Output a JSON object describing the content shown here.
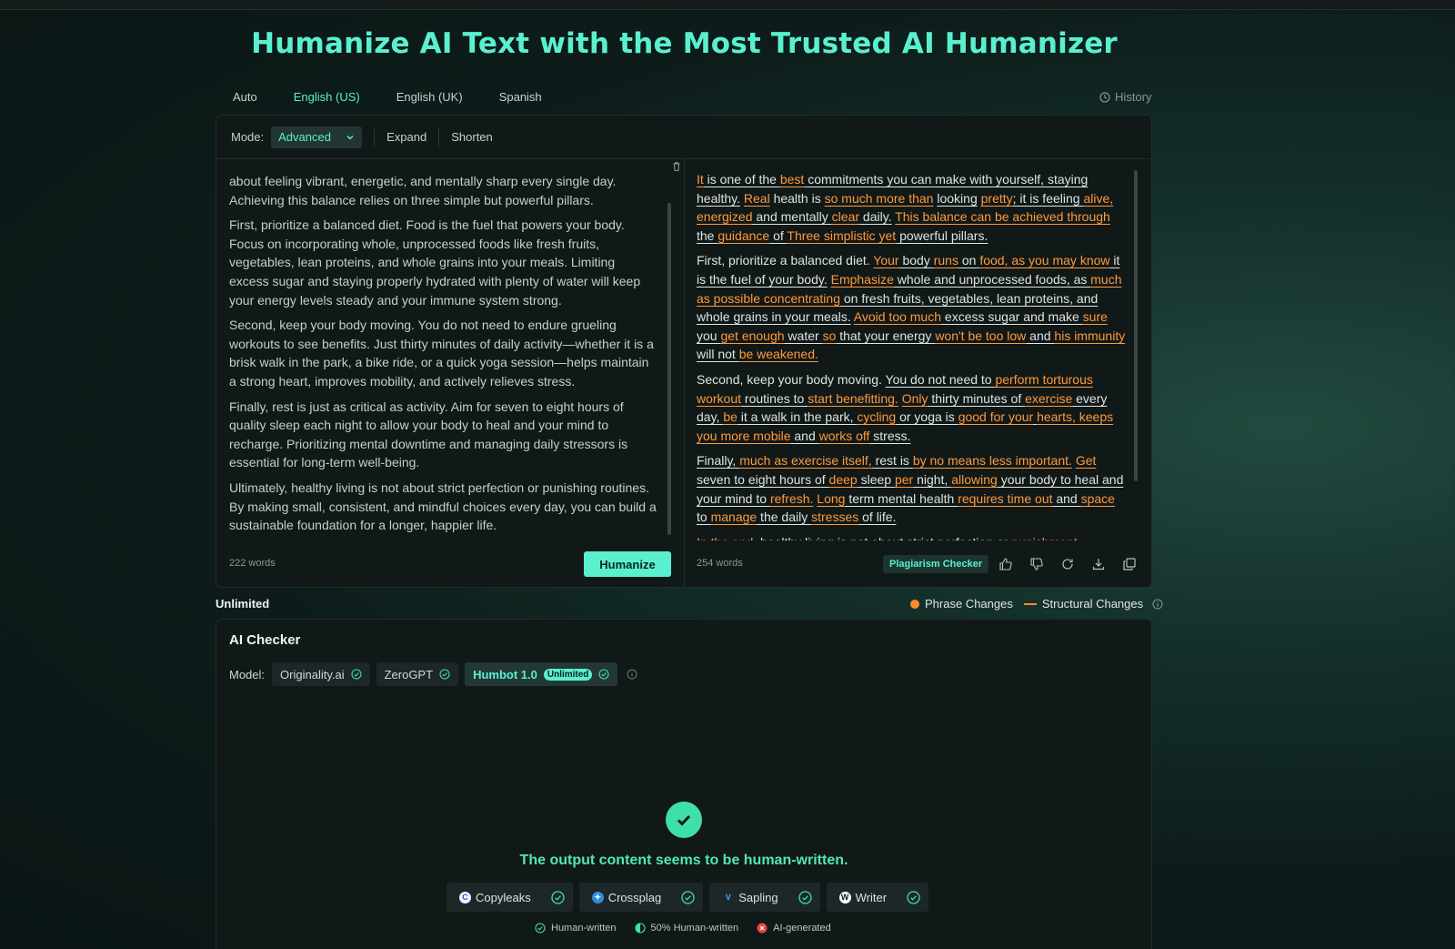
{
  "title": "Humanize AI Text with the Most Trusted AI Humanizer",
  "languages": {
    "auto": "Auto",
    "en_us": "English (US)",
    "en_uk": "English (UK)",
    "spanish": "Spanish"
  },
  "history_label": "History",
  "toolbar": {
    "mode_label": "Mode:",
    "mode_value": "Advanced",
    "expand": "Expand",
    "shorten": "Shorten"
  },
  "input": {
    "paragraphs": [
      "about feeling vibrant, energetic, and mentally sharp every single day. Achieving this balance relies on three simple but powerful pillars.",
      "First, prioritize a balanced diet. Food is the fuel that powers your body. Focus on incorporating whole, unprocessed foods like fresh fruits, vegetables, lean proteins, and whole grains into your meals. Limiting excess sugar and staying properly hydrated with plenty of water will keep your energy levels steady and your immune system strong.",
      "Second, keep your body moving. You do not need to endure grueling workouts to see benefits. Just thirty minutes of daily activity—whether it is a brisk walk in the park, a bike ride, or a quick yoga session—helps maintain a strong heart, improves mobility, and actively relieves stress.",
      "Finally, rest is just as critical as activity. Aim for seven to eight hours of quality sleep each night to allow your body to heal and your mind to recharge. Prioritizing mental downtime and managing daily stressors is essential for long-term well-being.",
      "Ultimately, healthy living is not about strict perfection or punishing routines. By making small, consistent, and mindful choices every day, you can build a sustainable foundation for a longer, happier life."
    ],
    "word_count": "222 words",
    "humanize_button": "Humanize"
  },
  "output": {
    "paragraphs": [
      [
        [
          "o",
          "It"
        ],
        [
          "w",
          " is one of the "
        ],
        [
          "o",
          "best"
        ],
        [
          "w",
          " commitments you can make with yourself, staying healthy."
        ],
        [
          "t",
          " "
        ],
        [
          "o",
          "Real"
        ],
        [
          "t",
          " health is "
        ],
        [
          "o",
          "so much more than"
        ],
        [
          "t",
          " "
        ],
        [
          "w",
          "looking"
        ],
        [
          "t",
          " "
        ],
        [
          "o",
          "pretty"
        ],
        [
          "w",
          "; it is feeling "
        ],
        [
          "o",
          "alive, energized"
        ],
        [
          "w",
          " and mentally "
        ],
        [
          "o",
          "clear"
        ],
        [
          "w",
          " daily."
        ],
        [
          "t",
          " "
        ],
        [
          "o",
          "This balance can be achieved through"
        ],
        [
          "t",
          " "
        ],
        [
          "w",
          "the "
        ],
        [
          "o",
          "guidance"
        ],
        [
          "w",
          " of "
        ],
        [
          "o",
          "Three simplistic yet"
        ],
        [
          "w",
          " powerful pillars."
        ]
      ],
      [
        [
          "t",
          "First, prioritize a balanced diet. "
        ],
        [
          "o",
          "Your"
        ],
        [
          "w",
          " body "
        ],
        [
          "o",
          "runs"
        ],
        [
          "w",
          " on "
        ],
        [
          "o",
          "food, as you may know"
        ],
        [
          "w",
          " it is the fuel of your body."
        ],
        [
          "t",
          " "
        ],
        [
          "o",
          "Emphasize"
        ],
        [
          "w",
          " whole and unprocessed foods, as "
        ],
        [
          "o",
          "much as possible concentrating"
        ],
        [
          "w",
          " on fresh fruits, vegetables, lean proteins, and whole grains in your meals."
        ],
        [
          "t",
          " "
        ],
        [
          "o",
          "Avoid too much"
        ],
        [
          "w",
          " excess sugar and make "
        ],
        [
          "o",
          "sure"
        ],
        [
          "w",
          " you "
        ],
        [
          "o",
          "get enough"
        ],
        [
          "w",
          " water "
        ],
        [
          "o",
          "so"
        ],
        [
          "w",
          " that your energy "
        ],
        [
          "o",
          "won't be too low"
        ],
        [
          "w",
          " and "
        ],
        [
          "o",
          "his immunity"
        ],
        [
          "w",
          " will not "
        ],
        [
          "o",
          "be weakened."
        ]
      ],
      [
        [
          "t",
          "Second, keep your body moving. "
        ],
        [
          "w",
          "You do not need to "
        ],
        [
          "o",
          "perform torturous workout"
        ],
        [
          "w",
          " routines to "
        ],
        [
          "o",
          "start benefitting."
        ],
        [
          "t",
          " "
        ],
        [
          "o",
          "Only"
        ],
        [
          "w",
          " thirty minutes of "
        ],
        [
          "o",
          "exercise"
        ],
        [
          "w",
          " every day, "
        ],
        [
          "o",
          "be"
        ],
        [
          "w",
          " it a walk in the park, "
        ],
        [
          "o",
          "cycling"
        ],
        [
          "w",
          " or yoga is "
        ],
        [
          "o",
          "good for your"
        ],
        [
          "w",
          " "
        ],
        [
          "o",
          "hearts, keeps"
        ],
        [
          "w",
          " "
        ],
        [
          "o",
          "you more mobile"
        ],
        [
          "w",
          " and "
        ],
        [
          "o",
          "works off"
        ],
        [
          "w",
          " stress."
        ]
      ],
      [
        [
          "w",
          "Finally, "
        ],
        [
          "o",
          "much as exercise itself,"
        ],
        [
          "w",
          " rest is "
        ],
        [
          "o",
          "by no means less important."
        ],
        [
          "t",
          " "
        ],
        [
          "o",
          "Get"
        ],
        [
          "w",
          " seven to eight hours of "
        ],
        [
          "o",
          "deep"
        ],
        [
          "w",
          " sleep "
        ],
        [
          "o",
          "per"
        ],
        [
          "w",
          " night, "
        ],
        [
          "o",
          "allowing"
        ],
        [
          "w",
          " your body to heal and your mind to "
        ],
        [
          "o",
          "refresh."
        ],
        [
          "t",
          " "
        ],
        [
          "o",
          "Long"
        ],
        [
          "w",
          " term mental health "
        ],
        [
          "o",
          "requires time out"
        ],
        [
          "w",
          " and "
        ],
        [
          "o",
          "space"
        ],
        [
          "w",
          " to "
        ],
        [
          "o",
          "manage"
        ],
        [
          "w",
          " the daily "
        ],
        [
          "o",
          "stresses"
        ],
        [
          "w",
          " of life."
        ]
      ],
      [
        [
          "o",
          "In the end"
        ],
        [
          "w",
          ", healthy living is not about strict perfection or "
        ],
        [
          "o",
          "punishment"
        ]
      ]
    ],
    "word_count": "254 words",
    "plagiarism_button": "Plagiarism Checker"
  },
  "usage": {
    "label": "Unlimited"
  },
  "legend": {
    "phrase": "Phrase Changes",
    "structural": "Structural Changes"
  },
  "checker": {
    "title": "AI Checker",
    "model_label": "Model:",
    "models": [
      "Originality.ai",
      "ZeroGPT",
      "Humbot 1.0"
    ],
    "humbot_badge": "Unlimited",
    "result_message": "The output content seems to be human-written.",
    "detectors": [
      "Copyleaks",
      "Crossplag",
      "Sapling",
      "Writer"
    ],
    "keys": {
      "human": "Human-written",
      "half": "50% Human-written",
      "ai": "AI-generated"
    }
  },
  "colors": {
    "accent": "#5af0cf",
    "change": "#ff9a3c",
    "success": "#3fe0a8",
    "ai": "#e84545"
  }
}
